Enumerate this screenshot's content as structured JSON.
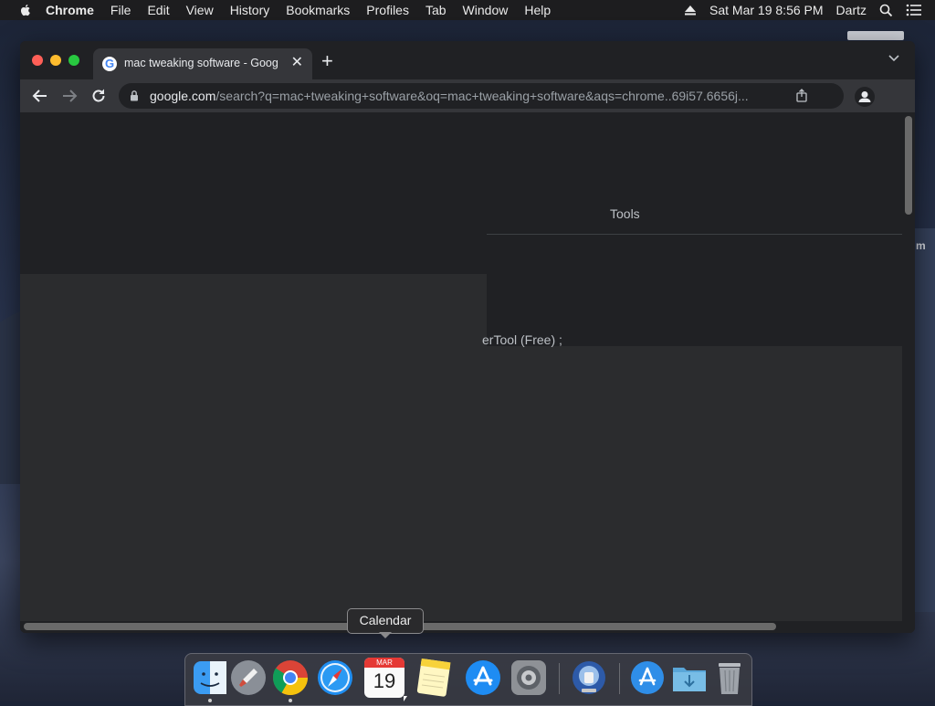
{
  "menubar": {
    "apple_icon": "apple-icon",
    "app_name": "Chrome",
    "items": [
      "File",
      "Edit",
      "View",
      "History",
      "Bookmarks",
      "Profiles",
      "Tab",
      "Window",
      "Help"
    ],
    "datetime": "Sat Mar 19  8:56 PM",
    "user": "Dartz"
  },
  "browser": {
    "tab_title": "mac tweaking software - Goog",
    "url_host": "google.com",
    "url_path": "/search?q=mac+tweaking+software&oq=mac+tweaking+software&aqs=chrome..69i57.6656j..."
  },
  "page": {
    "tools_label": "Tools",
    "snippet_text": "erTool (Free) ;"
  },
  "desktop": {
    "partial_label": "m"
  },
  "dock": {
    "tooltip": "Calendar",
    "calendar_month": "MAR",
    "calendar_day": "19"
  },
  "colors": {
    "window_bg": "#202124",
    "toolbar_bg": "#35363a",
    "content_bg": "#2b2c2e",
    "menubar_bg": "#1d1d1f"
  }
}
